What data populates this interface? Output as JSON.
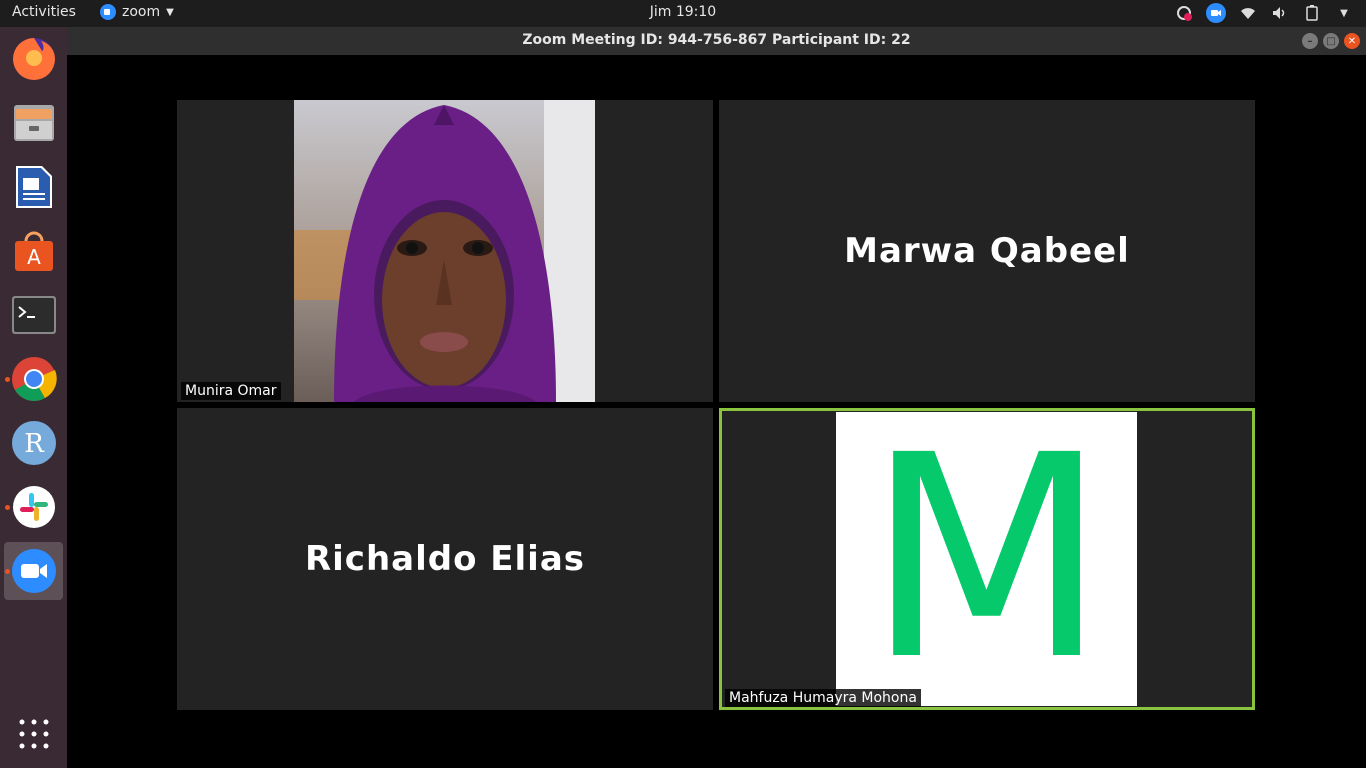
{
  "topbar": {
    "activities": "Activities",
    "app_name": "zoom",
    "clock": "Jim 19:10"
  },
  "window": {
    "title": "Zoom Meeting ID: 944-756-867 Participant ID: 22"
  },
  "dock": {
    "apps": [
      "Firefox",
      "Files",
      "LibreOffice Writer",
      "Ubuntu Software",
      "Terminal",
      "Chrome",
      "R",
      "Slack",
      "Zoom"
    ],
    "show_apps": "Show Applications"
  },
  "participants": [
    {
      "name": "Munira Omar",
      "video": true
    },
    {
      "name": "Marwa Qabeel",
      "video": false
    },
    {
      "name": "Richaldo Elias",
      "video": false
    },
    {
      "name": "Mahfuza Humayra Mohona",
      "video": true,
      "avatar_letter": "M",
      "active_speaker": true
    }
  ],
  "colors": {
    "speaker_border": "#8ac43f",
    "avatar_letter": "#05c96a",
    "zoom_blue": "#2d8cff"
  }
}
